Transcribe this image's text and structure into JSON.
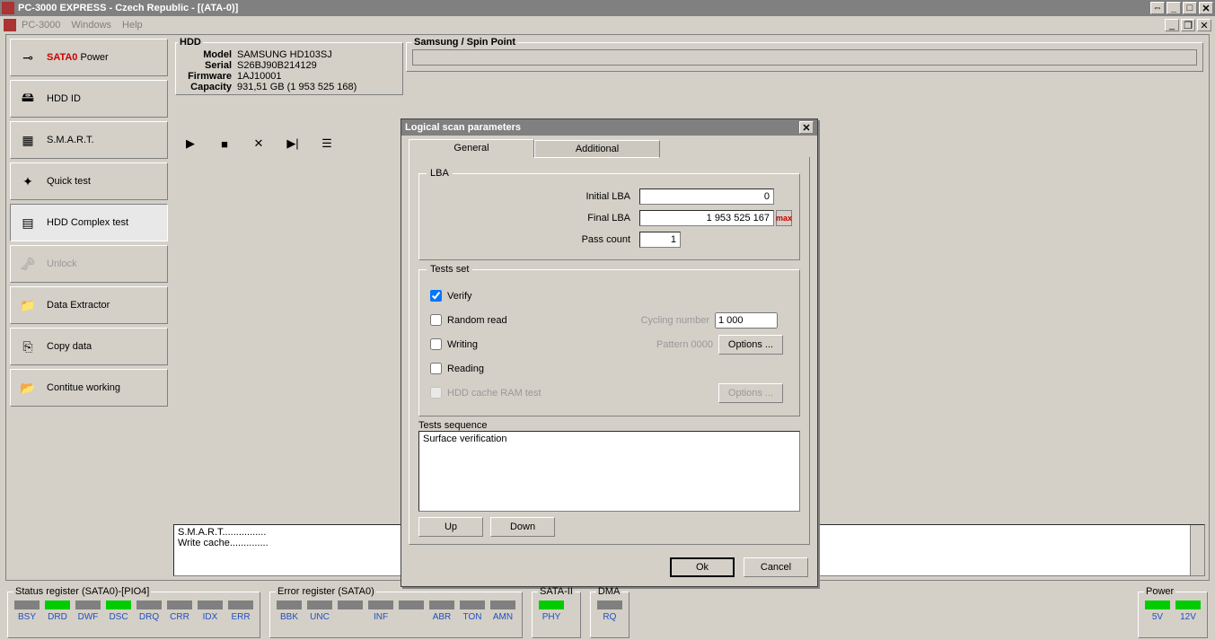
{
  "app": {
    "title": "PC-3000 EXPRESS - Czech Republic - [(ATA-0)]",
    "menu": {
      "m1": "PC-3000",
      "m2": "Windows",
      "m3": "Help"
    }
  },
  "sidebar": {
    "power": "Power",
    "sata": "SATA0",
    "items": [
      "HDD ID",
      "S.M.A.R.T.",
      "Quick test",
      "HDD Complex test",
      "Unlock",
      "Data Extractor",
      "Copy data",
      "Contitue working"
    ]
  },
  "hdd": {
    "title": "HDD",
    "model_l": "Model",
    "model_v": "SAMSUNG HD103SJ",
    "serial_l": "Serial",
    "serial_v": "S26BJ90B214129",
    "fw_l": "Firmware",
    "fw_v": "1AJ10001",
    "cap_l": "Capacity",
    "cap_v": "931,51 GB (1 953 525 168)"
  },
  "rightpanel": {
    "title": "Samsung / Spin Point"
  },
  "log": {
    "l1": "S.M.A.R.T................",
    "l2": "Write cache.............."
  },
  "dialog": {
    "title": "Logical scan parameters",
    "tab1": "General",
    "tab2": "Additional",
    "grp_lba": "LBA",
    "initial_l": "Initial LBA",
    "initial_v": "0",
    "final_l": "Final LBA",
    "final_v": "1 953 525 167",
    "pass_l": "Pass count",
    "pass_v": "1",
    "max": "max",
    "grp_tests": "Tests set",
    "verify": "Verify",
    "random": "Random read",
    "writing": "Writing",
    "reading": "Reading",
    "ram": "HDD cache RAM test",
    "cycling_l": "Cycling number",
    "cycling_v": "1 000",
    "pattern_l": "Pattern 0000",
    "options": "Options ...",
    "seq_l": "Tests sequence",
    "seq_item": "Surface verification",
    "up": "Up",
    "down": "Down",
    "ok": "Ok",
    "cancel": "Cancel"
  },
  "status": {
    "sr_title": "Status register (SATA0)-[PIO4]",
    "er_title": "Error register (SATA0)",
    "sata_title": "SATA-II",
    "dma_title": "DMA",
    "pwr_title": "Power",
    "sr": [
      "BSY",
      "DRD",
      "DWF",
      "DSC",
      "DRQ",
      "CRR",
      "IDX",
      "ERR"
    ],
    "sr_on": [
      false,
      true,
      false,
      true,
      false,
      false,
      false,
      false
    ],
    "er": [
      "BBK",
      "UNC",
      "",
      "INF",
      "",
      "ABR",
      "TON",
      "AMN"
    ],
    "sata": [
      "PHY"
    ],
    "dma": [
      "RQ"
    ],
    "pwr": [
      "5V",
      "12V"
    ]
  }
}
